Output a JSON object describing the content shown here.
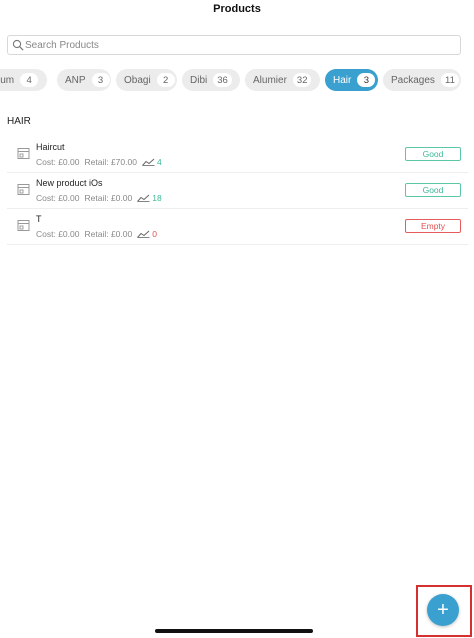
{
  "header": {
    "title": "Products"
  },
  "search": {
    "placeholder": "Search Products"
  },
  "categories": [
    {
      "label": "ium",
      "count": "4",
      "active": false
    },
    {
      "label": "ANP",
      "count": "3",
      "active": false
    },
    {
      "label": "Obagi",
      "count": "2",
      "active": false
    },
    {
      "label": "Dibi",
      "count": "36",
      "active": false
    },
    {
      "label": "Alumier",
      "count": "32",
      "active": false
    },
    {
      "label": "Hair",
      "count": "3",
      "active": true
    },
    {
      "label": "Packages",
      "count": "11",
      "active": false
    }
  ],
  "section": {
    "title": "HAIR"
  },
  "products": [
    {
      "name": "Haircut",
      "cost": "Cost: £0.00",
      "retail": "Retail: £70.00",
      "stock": "4",
      "status": "Good"
    },
    {
      "name": "New product iOs",
      "cost": "Cost: £0.00",
      "retail": "Retail: £0.00",
      "stock": "18",
      "status": "Good"
    },
    {
      "name": "T",
      "cost": "Cost: £0.00",
      "retail": "Retail: £0.00",
      "stock": "0",
      "status": "Empty"
    }
  ],
  "fab": {
    "label": "+"
  },
  "colors": {
    "accent": "#3aa0cf",
    "good": "#3bb89a",
    "empty": "#e25050",
    "highlight": "#d43030"
  },
  "icons": {
    "search": "search-icon",
    "product": "product-box-icon",
    "trend": "trend-chart-icon",
    "add": "plus-icon"
  }
}
